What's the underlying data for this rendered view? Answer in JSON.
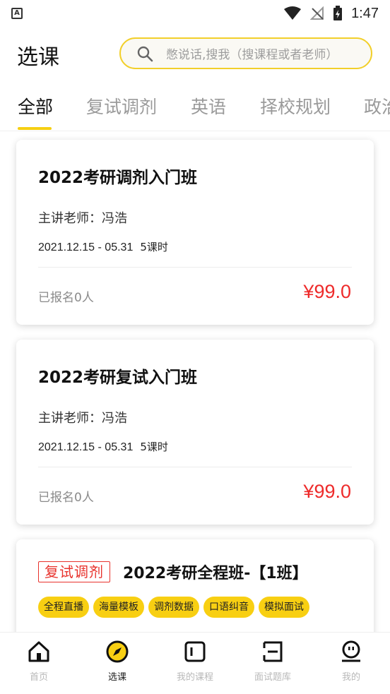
{
  "status_bar": {
    "time": "1:47",
    "app_icon_letter": "A"
  },
  "header": {
    "title": "选课",
    "search_placeholder": "憋说话,搜我（搜课程或者老师）"
  },
  "tabs": [
    {
      "label": "全部",
      "active": true
    },
    {
      "label": "复试调剂",
      "active": false
    },
    {
      "label": "英语",
      "active": false
    },
    {
      "label": "择校规划",
      "active": false
    },
    {
      "label": "政治",
      "active": false
    }
  ],
  "courses": [
    {
      "title": "2022考研调剂入门班",
      "teacher": "主讲老师：冯浩",
      "date": "2021.12.15 - 05.31",
      "hours": "5课时",
      "enrolled": "已报名0人",
      "price": "¥99.0"
    },
    {
      "title": "2022考研复试入门班",
      "teacher": "主讲老师：冯浩",
      "date": "2021.12.15 - 05.31",
      "hours": "5课时",
      "enrolled": "已报名0人",
      "price": "¥99.0"
    },
    {
      "tag": "复试调剂",
      "title": "2022考研全程班-【1班】",
      "features": [
        "全程直播",
        "海量模板",
        "调剂数据",
        "口语纠音",
        "模拟面试"
      ]
    }
  ],
  "bottom_nav": [
    {
      "label": "首页",
      "icon": "home-icon",
      "active": false
    },
    {
      "label": "选课",
      "icon": "compass-icon",
      "active": true
    },
    {
      "label": "我的课程",
      "icon": "course-icon",
      "active": false
    },
    {
      "label": "面试题库",
      "icon": "question-bank-icon",
      "active": false
    },
    {
      "label": "我的",
      "icon": "profile-icon",
      "active": false
    }
  ],
  "colors": {
    "accent": "#f8cf12",
    "price": "#ee2b2b",
    "tag_outline": "#e8322c"
  }
}
